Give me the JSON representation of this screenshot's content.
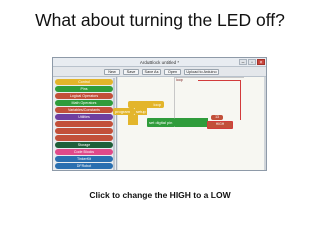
{
  "slide": {
    "title": "What about turning the LED off?",
    "caption": "Click to change the HIGH to a LOW"
  },
  "window": {
    "title": "ArduBlock untitled *",
    "controls": {
      "minimize": "–",
      "maximize": "▫",
      "close": "×"
    }
  },
  "toolbar": {
    "new_label": "New",
    "save_label": "Save",
    "save_as_label": "Save As",
    "open_label": "Open",
    "upload_label": "Upload to Arduino"
  },
  "palette": {
    "items": [
      {
        "label": "Control",
        "color": "#e3b52b"
      },
      {
        "label": "Pins",
        "color": "#2f9c3b"
      },
      {
        "label": "Logical Operators",
        "color": "#c2503a"
      },
      {
        "label": "Math Operators",
        "color": "#2f9c3b"
      },
      {
        "label": "Variables/Constants",
        "color": "#c2503a"
      },
      {
        "label": "Utilities",
        "color": "#6f3fa0"
      },
      {
        "label": "",
        "color": "#c2503a"
      },
      {
        "label": "",
        "color": "#c2503a"
      },
      {
        "label": "",
        "color": "#c2503a"
      },
      {
        "label": "Storage",
        "color": "#1f5f3a"
      },
      {
        "label": "Code Blocks",
        "color": "#e04a8a"
      },
      {
        "label": "TinkerKit",
        "color": "#2a6fb0"
      },
      {
        "label": "DFRobot",
        "color": "#2a6fb0"
      }
    ]
  },
  "canvas": {
    "blocks": {
      "loop_label": "loop",
      "program_label": "program",
      "setup_label": "setup",
      "set_digital_pin_label": "set digital pin",
      "pin_value": "13",
      "state_value": "HIGH"
    },
    "colors": {
      "control": "#e3b52b",
      "pins": "#2f9c3b",
      "value": "#c2503a",
      "highlight": "#d23b3b"
    }
  }
}
